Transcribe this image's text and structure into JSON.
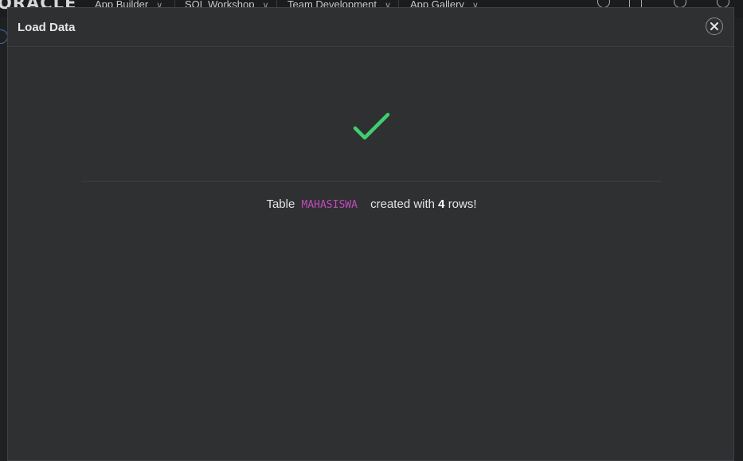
{
  "topnav": {
    "brand": "ORACLE",
    "tabs": [
      {
        "label": "App Builder"
      },
      {
        "label": "SQL Workshop"
      },
      {
        "label": "Team Development"
      },
      {
        "label": "App Gallery"
      }
    ]
  },
  "dialog": {
    "title": "Load Data",
    "close_icon": "close-icon",
    "status_icon": "checkmark-icon",
    "message": {
      "prefix": "Table",
      "table_name": "MAHASISWA",
      "middle": "created with",
      "row_count": "4",
      "suffix": "rows!"
    }
  },
  "colors": {
    "success": "#3fcf6e",
    "table_name": "#c04bbd",
    "dialog_bg": "#2f3032"
  }
}
